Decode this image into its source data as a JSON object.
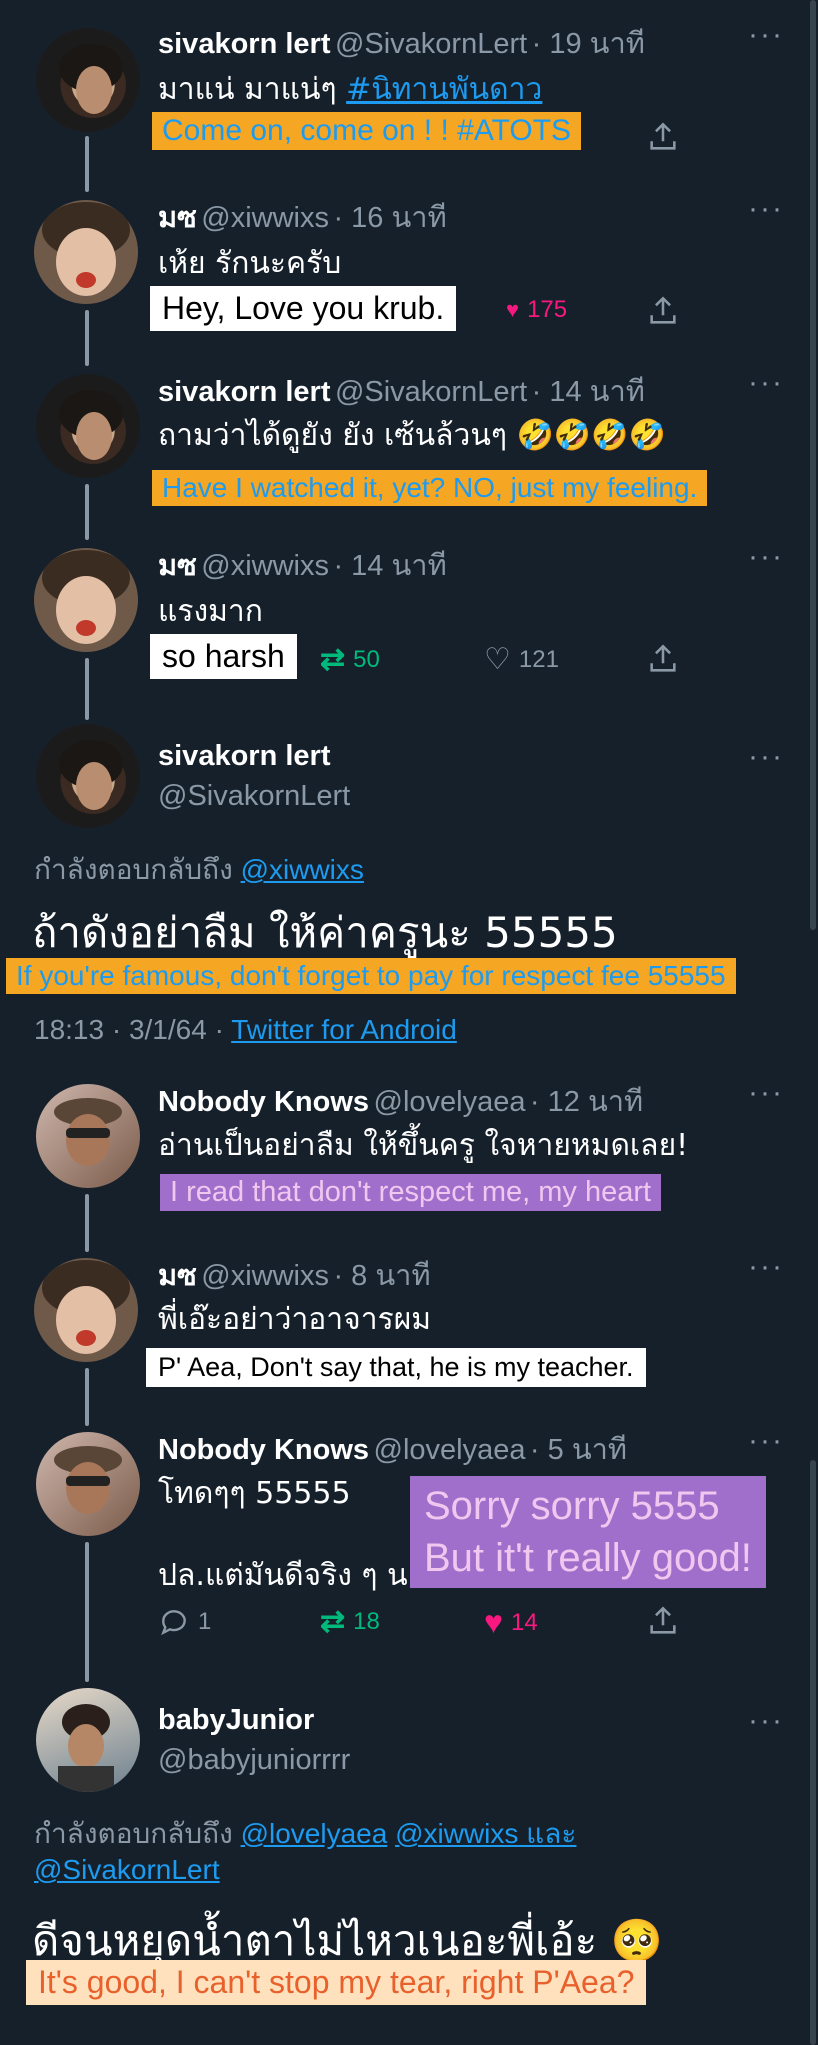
{
  "more_label": "···",
  "colors": {
    "bg": "#15202b",
    "link": "#1d9bf0",
    "retweet": "#00ba7c",
    "like": "#f91880",
    "subtitle_orange": "#f5a623",
    "subtitle_purple": "#a06ecb"
  },
  "tweets": [
    {
      "name": "sivakorn lert",
      "handle": "@SivakornLert",
      "time": "· 19 นาที",
      "text": "มาแน่ มาแน่ๆ ",
      "hashtag": "#นิทานพันดาว",
      "subtitle": "Come on, come on ! ! #ATOTS"
    },
    {
      "name": "มซ",
      "handle": "@xiwwixs",
      "time": "· 16 นาที",
      "text": "เห้ย รักนะครับ",
      "subtitle": "Hey, Love you krub.",
      "likes": "175"
    },
    {
      "name": "sivakorn lert",
      "handle": "@SivakornLert",
      "time": "· 14 นาที",
      "text": "ถามว่าได้ดูยัง ยัง เซ้นล้วนๆ 🤣🤣🤣🤣",
      "subtitle": "Have I watched it, yet? NO, just my feeling."
    },
    {
      "name": "มซ",
      "handle": "@xiwwixs",
      "time": "· 14 นาที",
      "text": "แรงมาก",
      "subtitle": "so harsh",
      "retweets": "50",
      "likes": "121"
    }
  ],
  "main_tweet": {
    "name": "sivakorn lert",
    "handle": "@SivakornLert",
    "replying_prefix": "กำลังตอบกลับถึง ",
    "replying_to": "@xiwwixs",
    "text": "ถ้าดังอย่าลืม ให้ค่าครูนะ 55555",
    "subtitle": "If you're famous, don't forget to pay for respect fee 55555",
    "timestamp": "18:13 · 3/1/64 · ",
    "client": "Twitter for Android"
  },
  "replies": [
    {
      "name": "Nobody Knows",
      "handle": "@lovelyaea",
      "time": "· 12 นาที",
      "text": "อ่านเป็นอย่าลืม ให้ขึ้นครู ใจหายหมดเลย!",
      "subtitle": "I read that don't respect me, my heart"
    },
    {
      "name": "มซ",
      "handle": "@xiwwixs",
      "time": "· 8 นาที",
      "text": "พี่เอ๊ะอย่าว่าอาจารผม",
      "subtitle": "P' Aea, Don't say that, he is my teacher."
    },
    {
      "name": "Nobody Knows",
      "handle": "@lovelyaea",
      "time": "· 5 นาที",
      "text": "โทดๆๆ 55555",
      "text2": "ปล.แต่มันดีจริง ๆ นะ",
      "subtitle_line1": "Sorry sorry 5555",
      "subtitle_line2": "But it't really good!",
      "replies": "1",
      "retweets": "18",
      "likes": "14"
    }
  ],
  "last_tweet": {
    "name": "babyJunior",
    "handle": "@babyjuniorrrr",
    "replying_prefix": "กำลังตอบกลับถึง ",
    "replying_to_1": "@lovelyaea",
    "replying_to_2": "@xiwwixs",
    "replying_and": " และ",
    "replying_to_3": "@SivakornLert",
    "text": "ดีจนหยุดน้ำตาไม่ไหวเนอะพี่เอ้ะ 🥺",
    "subtitle": "It's good, I can't stop my tear, right P'Aea?"
  }
}
